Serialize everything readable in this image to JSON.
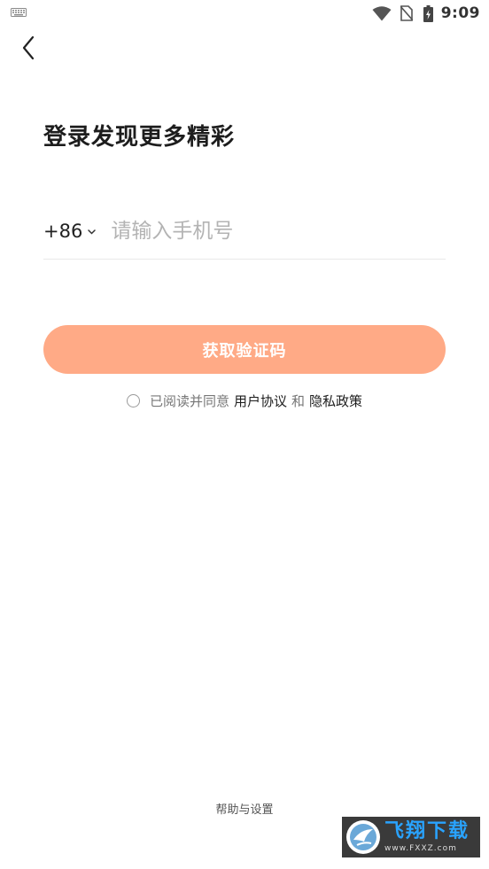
{
  "status_bar": {
    "time": "9:09",
    "icons": [
      "keyboard-icon",
      "wifi-icon",
      "no-sim-icon",
      "battery-charging-icon"
    ]
  },
  "header": {
    "back_icon": "back-arrow-icon"
  },
  "title": "登录发现更多精彩",
  "phone": {
    "country_code": "+86",
    "placeholder": "请输入手机号",
    "value": ""
  },
  "get_code_button": "获取验证码",
  "agreement": {
    "prefix": "已阅读并同意",
    "user_agreement": "用户协议",
    "and": "和",
    "privacy_policy": "隐私政策",
    "checked": false
  },
  "footer": {
    "help": "帮助与设置"
  },
  "watermark": {
    "title": "飞翔下载",
    "url": "www.FXXZ.com"
  },
  "colors": {
    "accent": "#ffaa86",
    "text_primary": "#1d1d1d",
    "text_secondary": "#777777",
    "placeholder": "#b3b3b3"
  }
}
